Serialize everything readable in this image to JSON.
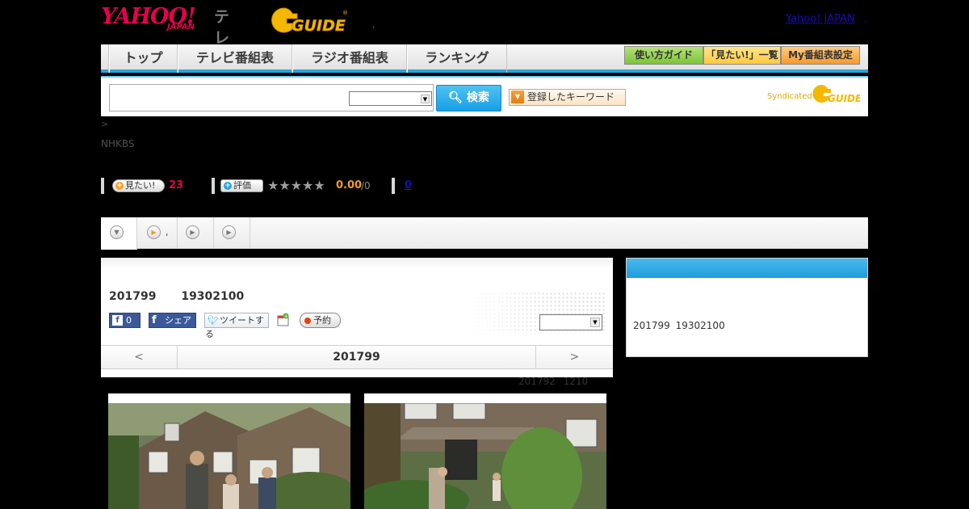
{
  "header": {
    "yahoo_logo": "YAHOO!",
    "yahoo_logo_sub": "JAPAN",
    "tv_label": "テレビ",
    "gguide_logo": "G GUIDE",
    "separator": ",",
    "yahoo_japan_link": "Yahoo! JAPAN",
    "yahoo_japan_link_suffix": ","
  },
  "nav": {
    "items": [
      "トップ",
      "テレビ番組表",
      "ラジオ番組表",
      "ランキング"
    ],
    "utility": [
      "使い方ガイド",
      "「見たい!」一覧",
      "My番組表設定"
    ],
    "colors": {
      "accent": "#2aa5dc",
      "guide_btn": "#8ccf3d",
      "mitai_btn": "#ffc93e",
      "my_btn": "#f7a13b"
    }
  },
  "search": {
    "input_value": "",
    "select_value": "",
    "button_label": "検索",
    "keyword_button": "登録したキーワード",
    "syndicated_label": "Syndicated"
  },
  "breadcrumb": ">",
  "channel": "NHKBS",
  "stats": {
    "want_label": "見たい!",
    "want_count": "23",
    "rate_label": "評価",
    "stars": "★★★★★",
    "rating": "0.00",
    "rating_denominator": "/0",
    "reviews": "0"
  },
  "tabs": {
    "second_tab_text": ","
  },
  "program": {
    "title": "201799 19302100",
    "fb_like_count": "0",
    "fb_share_label": "シェア",
    "tweet_label": "ツイートする",
    "reserve_label": "予約",
    "date_prev": "<",
    "date_current": "201799",
    "date_next": ">",
    "note": "201792 1210"
  },
  "side": {
    "text": "201799 19302100"
  }
}
